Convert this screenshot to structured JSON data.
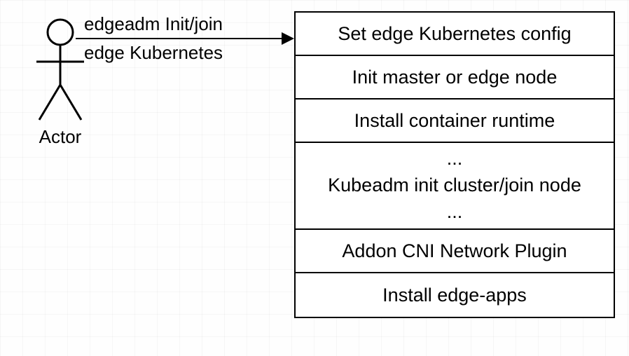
{
  "actor": {
    "label": "Actor"
  },
  "arrow": {
    "top_text": "edgeadm Init/join",
    "bottom_text": "edge Kubernetes"
  },
  "steps": [
    "Set edge Kubernetes config",
    "Init master or edge node",
    "Install container runtime",
    {
      "lines": [
        "...",
        "Kubeadm init cluster/join node",
        "..."
      ]
    },
    "Addon CNI Network Plugin",
    "Install edge-apps"
  ]
}
